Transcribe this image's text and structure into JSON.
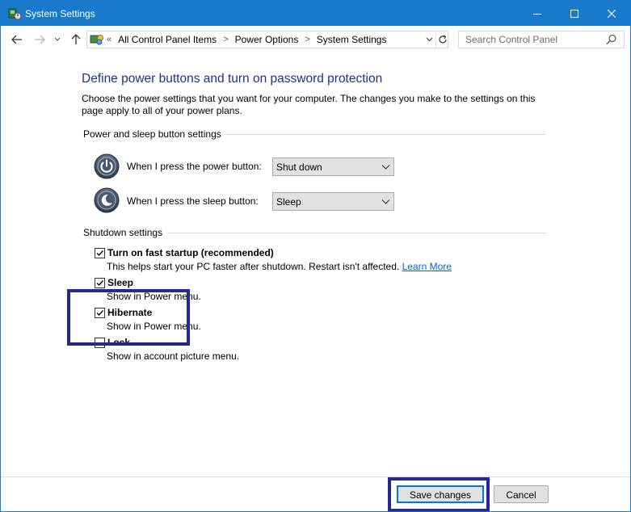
{
  "window": {
    "title": "System Settings"
  },
  "nav": {
    "breadcrumb_prefix": "«",
    "breadcrumbs": [
      "All Control Panel Items",
      "Power Options",
      "System Settings"
    ],
    "search_placeholder": "Search Control Panel"
  },
  "page": {
    "heading": "Define power buttons and turn on password protection",
    "description": "Choose the power settings that you want for your computer. The changes you make to the settings on this page apply to all of your power plans."
  },
  "power_sleep": {
    "title": "Power and sleep button settings",
    "power_label": "When I press the power button:",
    "power_value": "Shut down",
    "sleep_label": "When I press the sleep button:",
    "sleep_value": "Sleep"
  },
  "shutdown": {
    "title": "Shutdown settings",
    "items": [
      {
        "label": "Turn on fast startup (recommended)",
        "checked": true,
        "desc": "This helps start your PC faster after shutdown. Restart isn't affected.",
        "link": "Learn More"
      },
      {
        "label": "Sleep",
        "checked": true,
        "desc": "Show in Power menu."
      },
      {
        "label": "Hibernate",
        "checked": true,
        "desc": "Show in Power menu."
      },
      {
        "label": "Lock",
        "checked": false,
        "desc": "Show in account picture menu."
      }
    ]
  },
  "buttons": {
    "save": "Save changes",
    "cancel": "Cancel"
  },
  "colors": {
    "titlebar": "#1979ca",
    "heading": "#1e3287",
    "link": "#0066cc",
    "highlight": "#262891"
  }
}
